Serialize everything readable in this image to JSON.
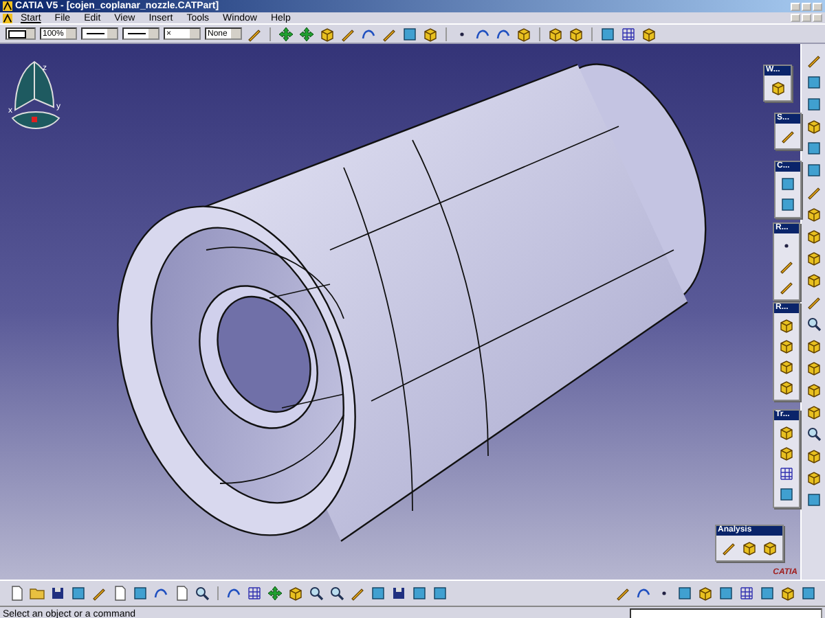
{
  "window": {
    "title": "CATIA V5 - [cojen_coplanar_nozzle.CATPart]"
  },
  "menu": [
    {
      "label": "Start"
    },
    {
      "label": "File"
    },
    {
      "label": "Edit"
    },
    {
      "label": "View"
    },
    {
      "label": "Insert"
    },
    {
      "label": "Tools"
    },
    {
      "label": "Window"
    },
    {
      "label": "Help"
    }
  ],
  "format_toolbar": [
    {
      "kind": "swatch"
    },
    {
      "kind": "text",
      "value": "100%"
    },
    {
      "kind": "line"
    },
    {
      "kind": "line"
    },
    {
      "kind": "text",
      "value": "×"
    },
    {
      "kind": "text",
      "value": "None"
    }
  ],
  "compass": {
    "axes": [
      "z",
      "x",
      "y"
    ]
  },
  "palettes": [
    {
      "title": "W..."
    },
    {
      "title": "S..."
    },
    {
      "title": "C..."
    },
    {
      "title": "R..."
    },
    {
      "title": "R..."
    },
    {
      "title": "Tr..."
    },
    {
      "title": "Analysis"
    }
  ],
  "logo": "CATIA",
  "status_bar": {
    "message": "Select an object or a command"
  }
}
